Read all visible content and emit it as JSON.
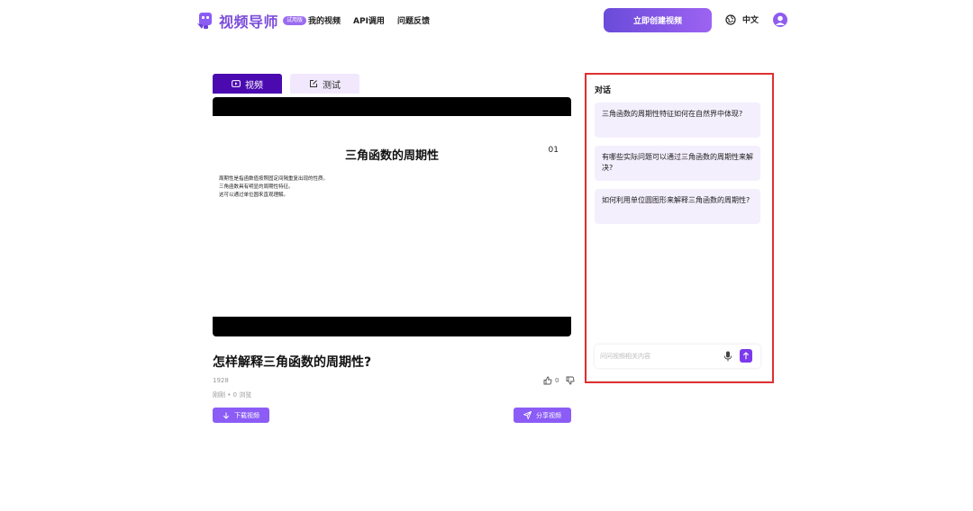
{
  "header": {
    "logo_text": "视频导师",
    "beta_badge": "试用版",
    "nav": [
      "我的视频",
      "API调用",
      "问题反馈"
    ],
    "create_button": "立即创建视频",
    "language": "中文"
  },
  "tabs": [
    {
      "label": "视频",
      "icon": "play-icon",
      "active": true
    },
    {
      "label": "测试",
      "icon": "edit-icon",
      "active": false
    }
  ],
  "slide": {
    "title": "三角函数的周期性",
    "number": "01",
    "lines": [
      "周期性是指函数值按照固定间隔重复出现的性质。",
      "三角函数具有明显的周期性特征。",
      "这可以通过单位圆来直观理解。"
    ]
  },
  "video": {
    "title": "怎样解释三角函数的周期性?",
    "id": "1928",
    "meta": "刚刚 • 0 浏览",
    "likes": "0",
    "download_label": "下载视频",
    "share_label": "分享视频"
  },
  "chat": {
    "title": "对话",
    "questions": [
      "三角函数的周期性特征如何在自然界中体现?",
      "有哪些实际问题可以通过三角函数的周期性来解决?",
      "如何利用单位圆图形来解释三角函数的周期性?"
    ],
    "input_placeholder": "问问视频相关内容"
  },
  "colors": {
    "brand": "#7c4ddb",
    "tab_active": "#4b0ab0",
    "button": "#8b5cf6",
    "highlight": "#e03030"
  }
}
